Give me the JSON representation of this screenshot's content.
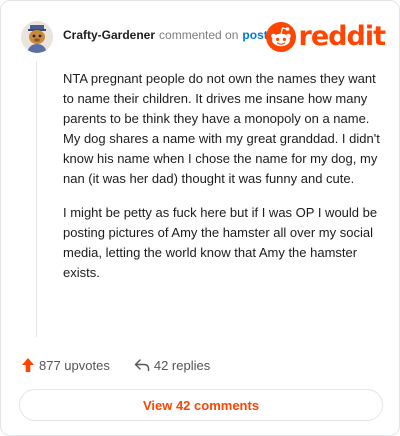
{
  "header": {
    "username": "Crafty-Gardener",
    "action_text": "commented on",
    "post_link": "post",
    "logo_text": "reddit",
    "logo_icon": "reddit-snoo-icon",
    "avatar_icon": "avatar-icon"
  },
  "comment": {
    "paragraphs": [
      "NTA pregnant people do not own the names they want to name their children. It drives me insane how many parents to be think they have a monopoly on a name. My dog shares a name with my great granddad. I didn't know his name when I chose the name for my dog, my nan (it was her dad) thought it was funny and cute.",
      "I might be petty as fuck here but if I was OP I would be posting pictures of Amy the hamster all over my social media, letting the world know that Amy the hamster exists."
    ]
  },
  "actions": {
    "upvotes": "877 upvotes",
    "replies": "42 replies",
    "upvote_icon": "upvote-arrow-icon",
    "reply_icon": "reply-arrow-icon"
  },
  "view_button": "View 42 comments",
  "colors": {
    "accent": "#ff4500",
    "link": "#0079d3",
    "muted": "#7c7c7c",
    "border": "#e3e6e8"
  }
}
